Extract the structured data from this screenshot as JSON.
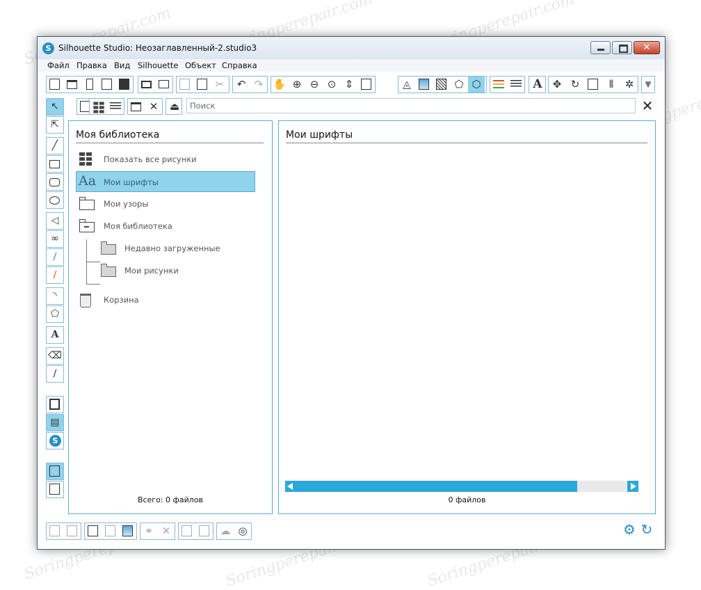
{
  "window": {
    "title": "Silhouette Studio: Неозаглавленный-2.studio3",
    "logo_letter": "S",
    "close_glyph": "✕"
  },
  "menu": [
    "Файл",
    "Правка",
    "Вид",
    "Silhouette",
    "Объект",
    "Справка"
  ],
  "toolbar": {
    "text_tool_glyph": "A",
    "items": [
      "new-document",
      "open-folder",
      "open-library",
      "save",
      "save-to-library",
      "print",
      "send-to-cutter",
      "copy",
      "paste",
      "cut",
      "undo",
      "redo",
      "pan",
      "zoom-in",
      "zoom-out",
      "zoom-select",
      "zoom-drag",
      "fit-to-page",
      "page-setup",
      "design-page",
      "fill-panel",
      "pattern-panel",
      "sketch-panel",
      "line-color",
      "line-style",
      "text-style",
      "replicate",
      "transform",
      "align",
      "offset",
      "trace",
      "more"
    ]
  },
  "search": {
    "placeholder": "Поиск",
    "close_glyph": "✕"
  },
  "library": {
    "title": "Моя библиотека",
    "items": [
      {
        "label": "Показать все рисунки",
        "icon": "grid-icon"
      },
      {
        "label": "Мои шрифты",
        "icon": "font-icon",
        "selected": true
      },
      {
        "label": "Мои узоры",
        "icon": "folder-icon"
      },
      {
        "label": "Моя библиотека",
        "icon": "folder-minus-icon"
      },
      {
        "label": "Недавно загруженные",
        "icon": "folder-filled-icon"
      },
      {
        "label": "Мои рисунки",
        "icon": "folder-filled-icon"
      },
      {
        "label": "Корзина",
        "icon": "trash-icon"
      }
    ],
    "font_glyph": "Aa",
    "total": "Всего: 0 файлов"
  },
  "fonts_panel": {
    "title": "Мои шрифты",
    "files": "0 файлов"
  },
  "left_tools": {
    "text_glyph": "A",
    "logo_letter": "S"
  },
  "watermark": "Soringperepair.com",
  "colors": {
    "accent": "#8fd3ec",
    "border": "#5aa9cf",
    "scroll": "#29a9d9"
  }
}
